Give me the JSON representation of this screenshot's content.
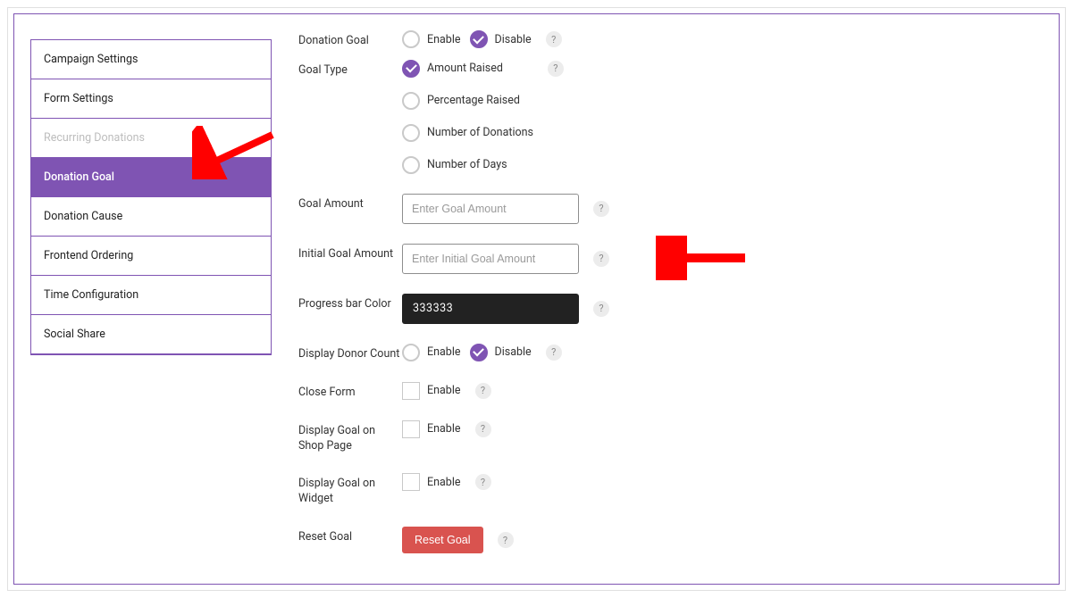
{
  "sidebar": {
    "items": [
      {
        "label": "Campaign Settings",
        "state": "normal"
      },
      {
        "label": "Form Settings",
        "state": "normal"
      },
      {
        "label": "Recurring Donations",
        "state": "disabled"
      },
      {
        "label": "Donation Goal",
        "state": "active"
      },
      {
        "label": "Donation Cause",
        "state": "normal"
      },
      {
        "label": "Frontend Ordering",
        "state": "normal"
      },
      {
        "label": "Time Configuration",
        "state": "normal"
      },
      {
        "label": "Social Share",
        "state": "normal"
      }
    ]
  },
  "form": {
    "donation_goal": {
      "label": "Donation Goal",
      "enable": "Enable",
      "disable": "Disable",
      "selected": "disable"
    },
    "goal_type": {
      "label": "Goal Type",
      "options": [
        {
          "label": "Amount Raised",
          "value": "amount",
          "selected": true
        },
        {
          "label": "Percentage Raised",
          "value": "percent",
          "selected": false
        },
        {
          "label": "Number of Donations",
          "value": "donations",
          "selected": false
        },
        {
          "label": "Number of Days",
          "value": "days",
          "selected": false
        }
      ]
    },
    "goal_amount": {
      "label": "Goal Amount",
      "placeholder": "Enter Goal Amount",
      "value": ""
    },
    "initial_goal_amount": {
      "label": "Initial Goal Amount",
      "placeholder": "Enter Initial Goal Amount",
      "value": ""
    },
    "progress_color": {
      "label": "Progress bar Color",
      "value": "333333"
    },
    "donor_count": {
      "label": "Display Donor Count",
      "enable": "Enable",
      "disable": "Disable",
      "selected": "disable"
    },
    "close_form": {
      "label": "Close Form",
      "enable": "Enable",
      "checked": false
    },
    "goal_shop": {
      "label": "Display Goal on Shop Page",
      "enable": "Enable",
      "checked": false
    },
    "goal_widget": {
      "label": "Display Goal on Widget",
      "enable": "Enable",
      "checked": false
    },
    "reset_goal": {
      "label": "Reset Goal",
      "button": "Reset Goal"
    }
  },
  "help_glyph": "?"
}
